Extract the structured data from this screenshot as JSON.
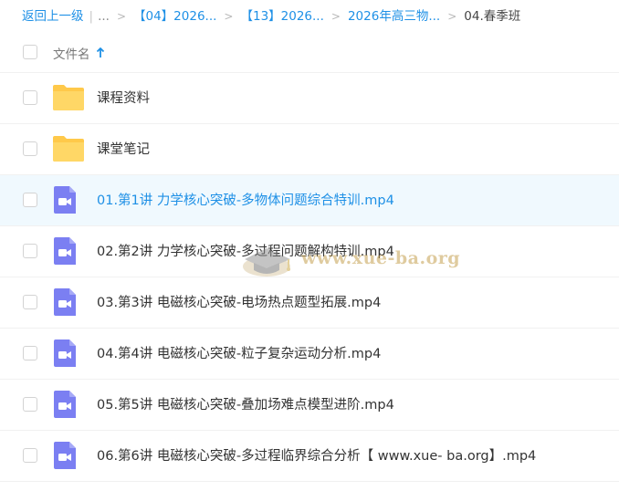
{
  "breadcrumb": {
    "back": "返回上一级",
    "ellipsis": "...",
    "items": [
      "【04】2026...",
      "【13】2026...",
      "2026年高三物..."
    ],
    "current": "04.春季班"
  },
  "header": {
    "column_name": "文件名"
  },
  "files": [
    {
      "name": "课程资料",
      "type": "folder"
    },
    {
      "name": "课堂笔记",
      "type": "folder"
    },
    {
      "name": "01.第1讲 力学核心突破-多物体问题综合特训.mp4",
      "type": "video"
    },
    {
      "name": "02.第2讲 力学核心突破-多过程问题解构特训.mp4",
      "type": "video"
    },
    {
      "name": "03.第3讲 电磁核心突破-电场热点题型拓展.mp4",
      "type": "video"
    },
    {
      "name": "04.第4讲 电磁核心突破-粒子复杂运动分析.mp4",
      "type": "video"
    },
    {
      "name": "05.第5讲 电磁核心突破-叠加场难点模型进阶.mp4",
      "type": "video"
    },
    {
      "name": "06.第6讲 电磁核心突破-多过程临界综合分析【 www.xue- ba.org】.mp4",
      "type": "video"
    }
  ],
  "watermark": {
    "text": "www.xue-ba.org"
  },
  "colors": {
    "accent": "#1e90e6",
    "folder": "#ffc94a",
    "video": "#7b7ff2",
    "selected_row": "#f0f9fe"
  }
}
